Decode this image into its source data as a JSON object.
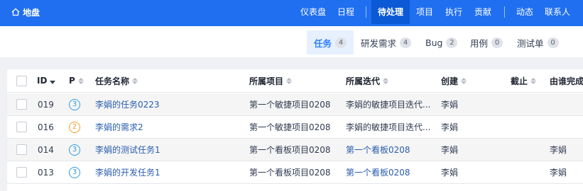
{
  "topnav": {
    "logo": "地盘",
    "items": [
      "仪表盘",
      "日程",
      "待处理",
      "项目",
      "执行",
      "贡献",
      "动态",
      "联系人"
    ],
    "active": "待处理"
  },
  "tabs": [
    {
      "label": "任务",
      "count": "4"
    },
    {
      "label": "研发需求",
      "count": "4"
    },
    {
      "label": "Bug",
      "count": "2"
    },
    {
      "label": "用例",
      "count": "0"
    },
    {
      "label": "测试单",
      "count": "0"
    }
  ],
  "table": {
    "columns": [
      "ID",
      "P",
      "任务名称",
      "所属项目",
      "所属迭代",
      "创建",
      "截止",
      "由谁完成"
    ],
    "rows": [
      {
        "id": "019",
        "p": "3",
        "name": "李娟的任务0223",
        "project": "第一个敏捷项目0208",
        "iteration": "李娟的敏捷项目迭代...",
        "creator": "李娟",
        "deadline": "",
        "finisher": ""
      },
      {
        "id": "016",
        "p": "2",
        "name": "李娟的需求2",
        "project": "第一个敏捷项目0208",
        "iteration": "李娟的敏捷项目迭代...",
        "creator": "李娟",
        "deadline": "",
        "finisher": ""
      },
      {
        "id": "014",
        "p": "3",
        "name": "李娟的测试任务1",
        "project": "第一个看板项目0208",
        "iteration": "第一个看板0208",
        "creator": "李娟",
        "deadline": "",
        "finisher": "李娟"
      },
      {
        "id": "013",
        "p": "3",
        "name": "李娟的开发任务1",
        "project": "第一个看板项目0208",
        "iteration": "第一个看板0208",
        "creator": "李娟",
        "deadline": "",
        "finisher": "李娟"
      }
    ]
  },
  "colors": {
    "nav_bg": "#1f6ff0",
    "nav_active_bg": "#0b59d4",
    "tab_active_bg": "#e6f0ff",
    "accent": "#2e7fff",
    "link": "#2a5db0",
    "priority_3": "#2e9cde",
    "priority_2": "#f0a02b"
  }
}
